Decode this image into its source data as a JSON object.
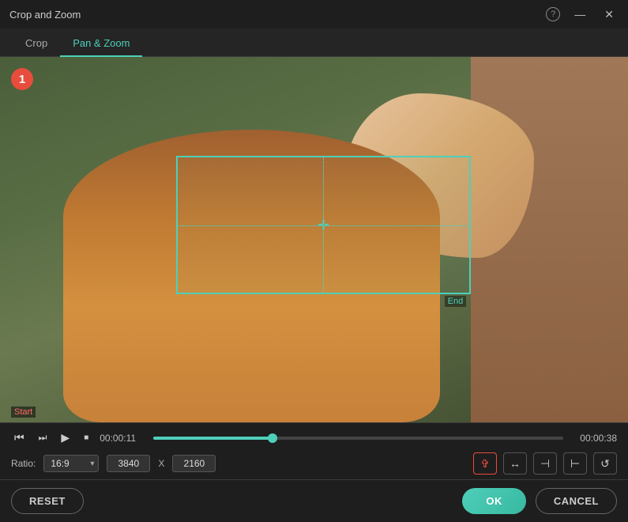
{
  "titlebar": {
    "title": "Crop and Zoom",
    "help_label": "?",
    "minimize_label": "—",
    "close_label": "✕"
  },
  "tabs": [
    {
      "id": "crop",
      "label": "Crop",
      "active": false
    },
    {
      "id": "pan-zoom",
      "label": "Pan & Zoom",
      "active": true
    }
  ],
  "video": {
    "badge": "1",
    "start_label": "Start",
    "end_label": "End",
    "frame_label_start": "Start",
    "frame_label_end": "End"
  },
  "playback": {
    "current_time": "00:00:11",
    "total_time": "00:00:38",
    "progress_percent": 29
  },
  "ratio": {
    "label": "Ratio:",
    "value": "16:9",
    "width": "3840",
    "separator": "X",
    "height": "2160"
  },
  "tools": {
    "fit_icon": "⤢",
    "flip_h_icon": "↔",
    "align_left_icon": "⊣",
    "align_right_icon": "⊢",
    "rotate_icon": "↺"
  },
  "actions": {
    "reset_label": "RESET",
    "ok_label": "OK",
    "cancel_label": "CANCEL"
  },
  "icons": {
    "prev_frame": "⏮",
    "step_back": "⏭",
    "play": "▶",
    "stop": "■"
  }
}
